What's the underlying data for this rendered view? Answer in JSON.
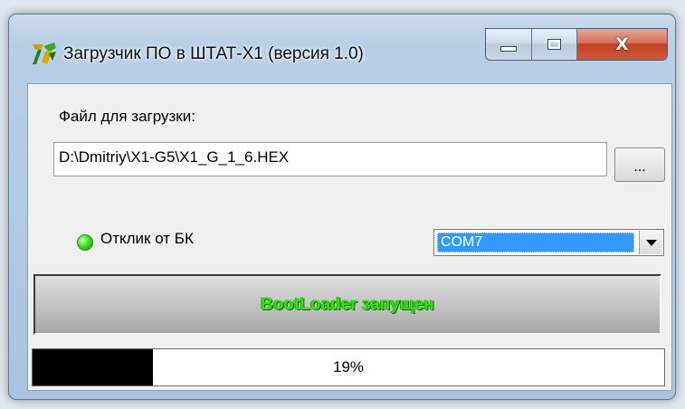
{
  "window": {
    "title": "Загрузчик ПО в ШТАТ-Х1 (версия 1.0)",
    "icon": "app-icon",
    "controls": {
      "minimize_icon": "minimize-icon",
      "maximize_icon": "maximize-icon",
      "close_glyph": "X"
    }
  },
  "file": {
    "label": "Файл для загрузки:",
    "path": "D:\\Dmitriy\\X1-G5\\X1_G_1_6.HEX",
    "browse_label": "..."
  },
  "response": {
    "indicator_color": "#3ee026",
    "label": "Отклик от БК"
  },
  "port": {
    "selected": "COM7"
  },
  "status": {
    "text": "BootLoader запущен",
    "color": "#33e012"
  },
  "progress": {
    "value": 0.19,
    "label": "19%"
  }
}
